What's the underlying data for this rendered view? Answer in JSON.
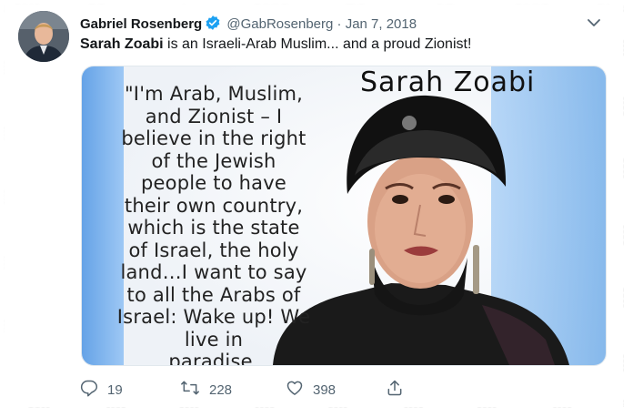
{
  "tweet": {
    "author_name": "Gabriel Rosenberg",
    "handle": "@GabRosenberg",
    "separator": "·",
    "date": "Jan 7, 2018",
    "verified": true,
    "text_bold": "Sarah Zoabi",
    "text_rest": " is an Israeli-Arab Muslim... and a proud Zionist!"
  },
  "media": {
    "overlay_name": "Sarah Zoabi",
    "quote_lines": [
      "\"I'm Arab, Muslim,",
      "and Zionist – I",
      "believe in the right",
      "of the Jewish",
      "people to have",
      "their own country,",
      "which is the state",
      "of Israel, the holy",
      "land…I want to say",
      "to all the Arabs of",
      "Israel: Wake up! We",
      "live in",
      "paradise."
    ]
  },
  "actions": {
    "reply_count": "19",
    "retweet_count": "228",
    "like_count": "398"
  },
  "colors": {
    "text_primary": "#14171a",
    "text_secondary": "#536471",
    "verified_blue": "#1da1f2",
    "flag_blue": "#5aa0e6"
  },
  "icons": {
    "verified": "verified-badge-icon",
    "caret": "chevron-down-icon",
    "reply": "reply-icon",
    "retweet": "retweet-icon",
    "like": "heart-icon",
    "share": "share-icon"
  }
}
